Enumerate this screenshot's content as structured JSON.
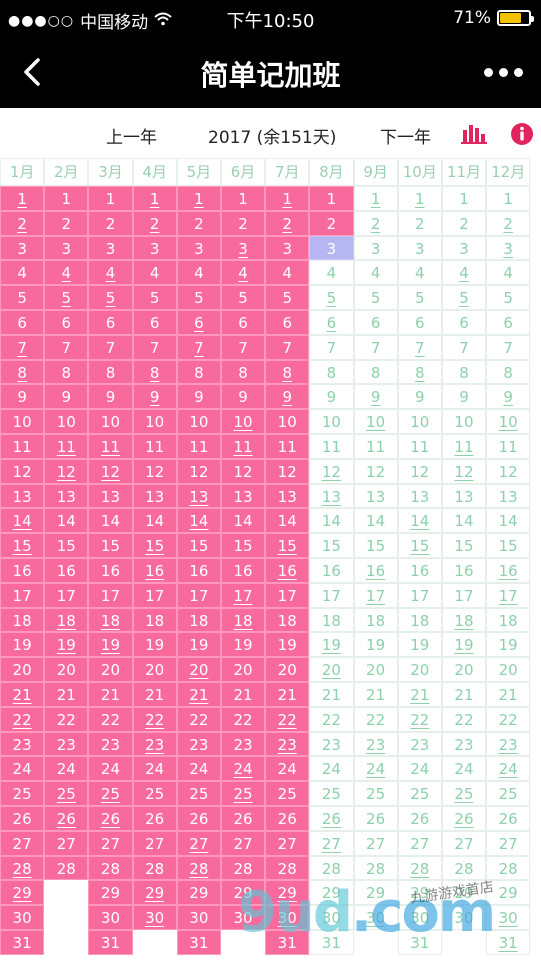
{
  "status_bar": {
    "carrier": "中国移动",
    "time": "下午10:50",
    "battery": "71%",
    "battery_level": 0.71
  },
  "nav": {
    "title": "简单记加班"
  },
  "toolbar": {
    "prev_label": "上一年",
    "year_label": "2017 (余151天)",
    "next_label": "下一年",
    "chart_icon": "bar-chart-icon",
    "info_icon": "info-icon"
  },
  "calendar": {
    "months": [
      "1月",
      "2月",
      "3月",
      "4月",
      "5月",
      "6月",
      "7月",
      "8月",
      "9月",
      "10月",
      "11月",
      "12月"
    ],
    "days_in_month": [
      31,
      28,
      31,
      30,
      31,
      30,
      31,
      31,
      30,
      31,
      30,
      31
    ],
    "filled_through": {
      "month": 8,
      "day": 2
    },
    "today": {
      "month": 8,
      "day": 3
    },
    "underlined": {
      "1": [
        1,
        2,
        7,
        8,
        14,
        15,
        21,
        22,
        28,
        29
      ],
      "2": [
        4,
        5,
        11,
        12,
        18,
        19,
        25,
        26
      ],
      "3": [
        4,
        5,
        11,
        12,
        18,
        19,
        25,
        26
      ],
      "4": [
        1,
        2,
        8,
        9,
        15,
        16,
        22,
        23,
        29,
        30
      ],
      "5": [
        1,
        6,
        7,
        13,
        14,
        20,
        21,
        27,
        28
      ],
      "6": [
        3,
        4,
        10,
        11,
        17,
        18,
        24,
        25
      ],
      "7": [
        1,
        2,
        8,
        9,
        15,
        16,
        22,
        23,
        29,
        30
      ],
      "8": [
        5,
        6,
        12,
        13,
        19,
        20,
        26,
        27
      ],
      "9": [
        1,
        2,
        9,
        10,
        16,
        17,
        23,
        24,
        30
      ],
      "10": [
        1,
        7,
        8,
        14,
        15,
        21,
        22,
        28,
        29
      ],
      "11": [
        4,
        5,
        11,
        12,
        18,
        19,
        25,
        26
      ],
      "12": [
        2,
        3,
        9,
        10,
        16,
        17,
        23,
        24,
        30,
        31
      ]
    },
    "colors": {
      "filled": "#f86a9c",
      "empty_text": "#8dd1ab",
      "today": "#b6b6f2"
    }
  },
  "watermark": {
    "text": "9ud",
    "dotcom": ".com",
    "sub": "九游游戏首店"
  }
}
